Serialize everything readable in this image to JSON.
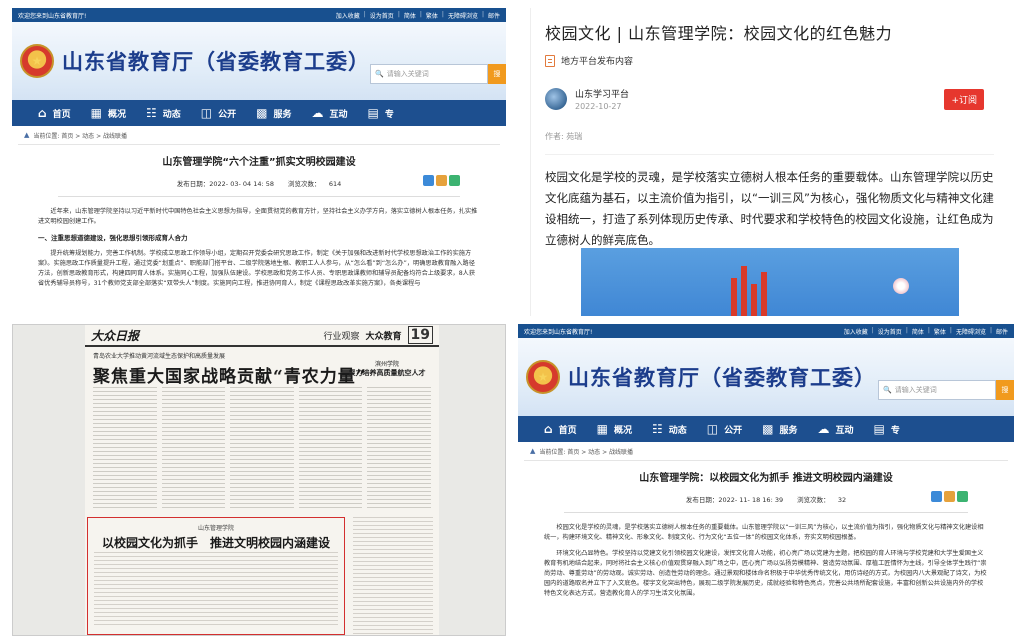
{
  "site": {
    "welcome": "欢迎您来到山东省教育厅!",
    "top_links": [
      "加入收藏",
      "设为首页",
      "简体",
      "繁体",
      "无障碍浏览",
      "邮件"
    ],
    "title": "山东省教育厅（省委教育工委）",
    "search_placeholder": "请输入关键词",
    "search_button": "搜",
    "nav": [
      {
        "label": "首页",
        "icon": "home-icon"
      },
      {
        "label": "概况",
        "icon": "building-icon"
      },
      {
        "label": "动态",
        "icon": "news-icon"
      },
      {
        "label": "公开",
        "icon": "book-icon"
      },
      {
        "label": "服务",
        "icon": "grid-icon"
      },
      {
        "label": "互动",
        "icon": "chat-icon"
      },
      {
        "label": "专",
        "icon": "doc-icon"
      }
    ],
    "breadcrumb": "当前位置: 首页 > 动态 > 战线联播"
  },
  "article_tl": {
    "title": "山东管理学院“六个注重”抓实文明校园建设",
    "publish_label": "发布日期：",
    "publish_date": "2022- 03- 04 14: 58",
    "views_label": "浏览次数：",
    "views": "614",
    "paragraphs": [
      "近年来，山东管理学院坚持以习近平新时代中国特色社会主义思想为指导，全面贯彻党的教育方针，坚持社会主义办学方向，落实立德树人根本任务，扎实推进文明校园创建工作。",
      "提升统筹规划能力，完善工作机制。学校成立思政工作领导小组，定期召开党委会研究思政工作，制定《关于加强和改进新时代学校思想政治工作的实施方案》。实施思政工作质量提升工程，通过党委“划重点”、职能部门搭平台、二级学院落地生根、教职工人人参与，从“怎么看”到“怎么办”，明确思政教育融入路径方法，创新思政教育形式，构建四同育人体系。实施同心工程，加强队伍建设。学校思政和党务工作人员、专职思政课教师和辅导员配备均符合上级要求，8人获省优秀辅导员称号，31个教师党支部全部落实“双带头人”制度。实施同向工程，推进协同育人，制定《课程思政改革实施方案》，各类课程与"
    ],
    "section_heading": "一、注重思想道德建设，强化思想引领形成育人合力"
  },
  "article_tr": {
    "title": "校园文化 | 山东管理学院：校园文化的红色魅力",
    "source_label": "地方平台发布内容",
    "author": "山东学习平台",
    "date": "2022-10-27",
    "subscribe": "+订阅",
    "author_line": "作者: 苑瑞",
    "body": "校园文化是学校的灵魂，是学校落实立德树人根本任务的重要载体。山东管理学院以历史文化底蕴为基石，以主流价值为指引，以“一训三风”为核心，强化物质文化与精神文化建设相统一，打造了系列体现历史传承、时代要求和学校特色的校园文化设施，让红色成为立德树人的鲜亮底色。"
  },
  "newspaper": {
    "logo": "大众日报",
    "section": "行业观察",
    "brand": "大众教育",
    "page": "19",
    "kicker": "青岛农业大学推动黄河流域生态保护和高质量发展",
    "headline": "聚焦重大国家战略贡献“青农力量”",
    "side_kicker": "滨州学院",
    "side_headline": "聚力培养高质量航空人才",
    "box_kicker": "山东管理学院",
    "box_headline": "以校园文化为抓手　推进文明校园内涵建设"
  },
  "article_br": {
    "title": "山东管理学院：以校园文化为抓手 推进文明校园内涵建设",
    "publish_label": "发布日期：",
    "publish_date": "2022- 11- 18 16: 39",
    "views_label": "浏览次数：",
    "views": "32",
    "paragraphs": [
      "校园文化是学校的灵魂，是学校落实立德树人根本任务的重要载体。山东管理学院以“一训三风”为核心，以主流价值为指引，强化物质文化与精神文化建设相统一，构建环境文化、精神文化、形象文化、制度文化、行为文化“五位一体”的校园文化体系，夯实文明校园根基。",
      "环境文化凸显特色。学校坚持以党建文化引领校园文化建设，发挥文化育人功能，初心亮广场以党建为主题，把校园的育人环境与学校党建和大学生爱国主义教育有机地结合起来，同时将社会主义核心价值观贯穿融入到广场之中，匠心亮广场以弘扬劳模精神、营造劳动氛围、厚植工匠情怀为主线，引导全体学生践行“崇尚劳动、尊重劳动”的劳动观。诚实劳动、创造性劳动的理念。通过景观和楼体命名积极于中华优秀传统文化，用仿诗经的方式，为校园内八大景观配了诗文，为校园内的道路取名并立下了入文底色。楼宇文化突出特色，展现二级学院发展历史，成就经验和特色亮点，完善公共场所配套设施，丰富和创新公共设施内外的学校特色文化表达方式，营造教化育人的学习生活文化氛围。"
    ]
  }
}
